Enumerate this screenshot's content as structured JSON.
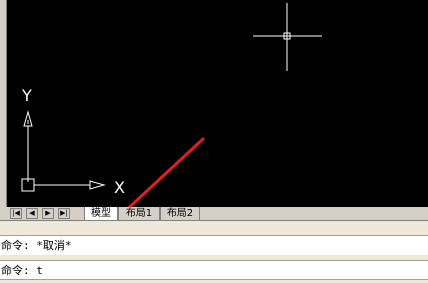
{
  "drawing_area": {
    "axis_x_label": "X",
    "axis_y_label": "Y",
    "background_color": "#000000",
    "arrow_color": "#e02020"
  },
  "tabs": {
    "nav_buttons": [
      "first-icon",
      "prev-icon",
      "next-icon",
      "last-icon"
    ],
    "items": [
      {
        "label": "模型",
        "active": true
      },
      {
        "label": "布局1",
        "active": false
      },
      {
        "label": "布局2",
        "active": false
      }
    ]
  },
  "command": {
    "history_line": "命令: *取消*",
    "current_line": "命令: t"
  }
}
